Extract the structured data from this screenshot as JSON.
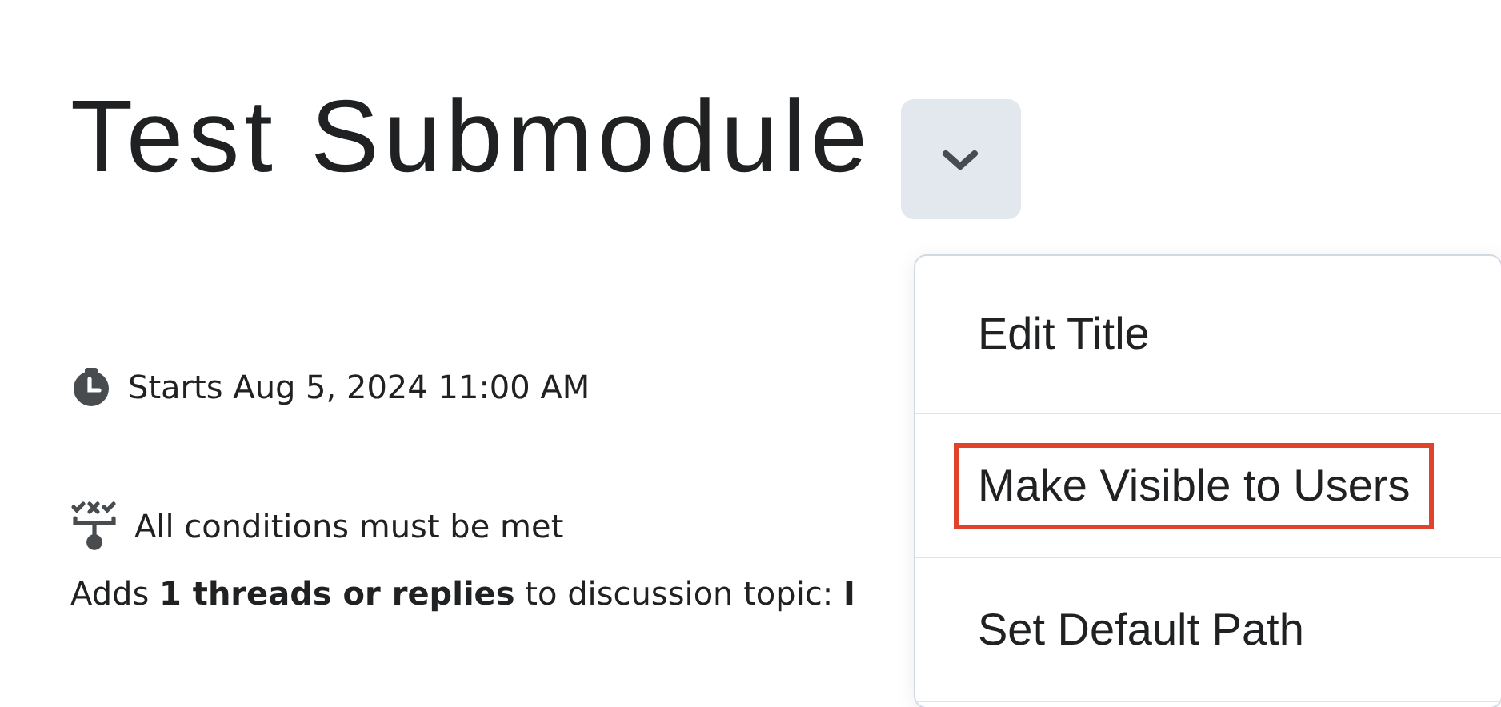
{
  "title": "Test Submodule",
  "start": {
    "text": "Starts Aug 5, 2024 11:00 AM"
  },
  "conditions": {
    "text": "All conditions must be met"
  },
  "requirement": {
    "text": "Adds **1 threads or replies** to discussion topic: **I**"
  },
  "menu": {
    "items": [
      {
        "label": "Edit Title",
        "highlighted": false
      },
      {
        "label": "Make Visible to Users",
        "highlighted": true
      },
      {
        "label": "Set Default Path",
        "highlighted": false
      }
    ]
  }
}
